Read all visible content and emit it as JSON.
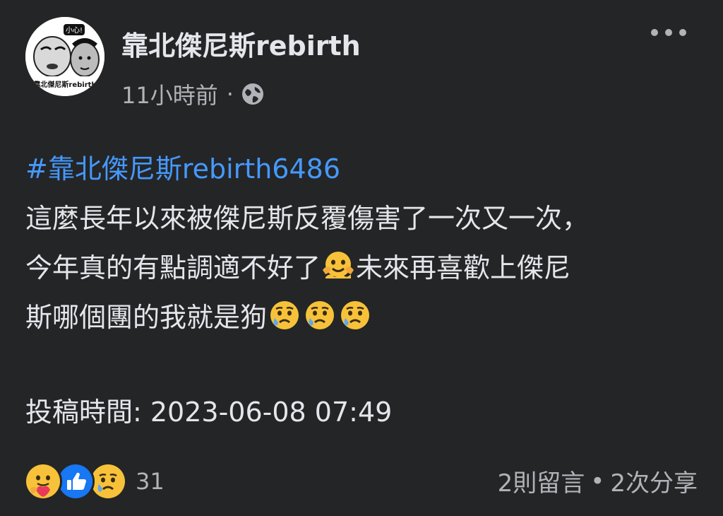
{
  "header": {
    "page_name": "靠北傑尼斯rebirth",
    "timestamp": "11小時前",
    "separator": "·",
    "privacy_icon": "globe-icon",
    "more_icon": "more-horizontal-icon",
    "avatar": {
      "badge_text": "小心!",
      "caption": "靠北傑尼斯rebirth"
    }
  },
  "post": {
    "hashtag": "#靠北傑尼斯rebirth6486",
    "line1": "這麼長年以來被傑尼斯反覆傷害了一次又一次，",
    "line2_before": "今年真的有點調適不好了",
    "line2_emoji": "melting-face-hands-emoji",
    "line2_after": "未來再喜歡上傑尼",
    "line3": "斯哪個團的我就是狗",
    "line3_emojis": [
      "sad-relieved-face-emoji",
      "sad-relieved-face-emoji",
      "sad-relieved-face-emoji"
    ],
    "submit_time": "投稿時間: 2023-06-08 07:49"
  },
  "footer": {
    "reaction_icons": [
      "care-reaction-icon",
      "like-reaction-icon",
      "sad-reaction-icon"
    ],
    "reaction_count": "31",
    "comments": "2則留言",
    "dot": "•",
    "shares": "2次分享"
  },
  "colors": {
    "background": "#242526",
    "text": "#e4e6eb",
    "secondary_text": "#b0b3b8",
    "hashtag": "#4599ff",
    "like_blue": "#1877f2"
  }
}
